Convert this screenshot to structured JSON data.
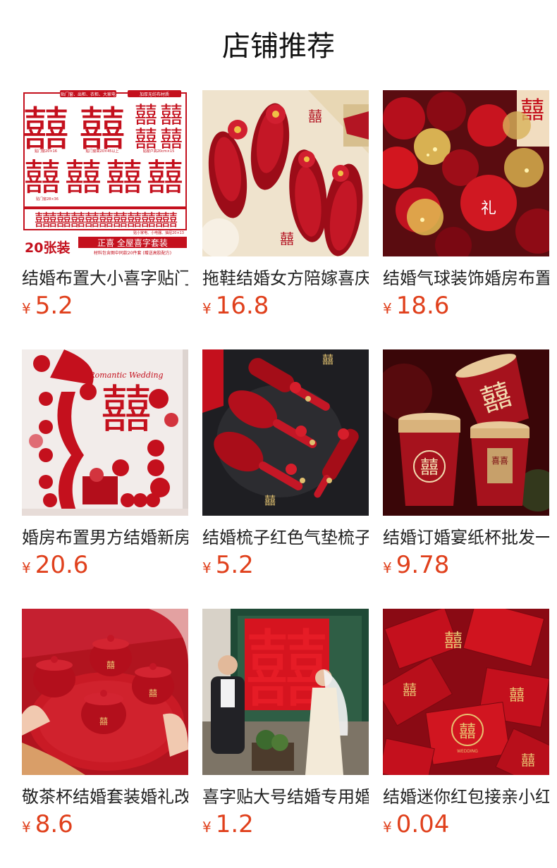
{
  "page_title": "店铺推荐",
  "products": [
    {
      "name": "结婚布置大小喜字贴门窗贴",
      "currency": "¥",
      "price": "5.2",
      "image_text": {
        "top1": "贴门窗、出柜、衣柜、大家电",
        "top2": "加厚无纺布材质",
        "big": "囍",
        "count": "20张装",
        "banner": "正喜  全屋喜字套装",
        "note": "材料包含图中同款20件套 (赠送高胶配方)",
        "small1": "贴门窗20×16",
        "small2": "贴门窗高20×45以上",
        "small3": "贴窗户高20cm×15",
        "small4": "贴门窗28×36",
        "small5": "贴小家电、小电器、抽屉20×13"
      }
    },
    {
      "name": "拖鞋结婚女方陪嫁喜庆红色",
      "currency": "¥",
      "price": "16.8",
      "image_text": {
        "big": "囍"
      }
    },
    {
      "name": "结婚气球装饰婚房布置套装",
      "currency": "¥",
      "price": "18.6",
      "image_text": {
        "big": "囍",
        "mark": "礼"
      }
    },
    {
      "name": "婚房布置男方结婚新房装饰",
      "currency": "¥",
      "price": "20.6",
      "image_text": {
        "big": "囍",
        "script": "Romantic Wedding"
      }
    },
    {
      "name": "结婚梳子红色气垫梳子陪嫁",
      "currency": "¥",
      "price": "5.2",
      "image_text": {
        "big": "囍"
      }
    },
    {
      "name": "结婚订婚宴纸杯批发一次性",
      "currency": "¥",
      "price": "9.78",
      "image_text": {
        "big": "囍",
        "cup": "喜喜"
      }
    },
    {
      "name": "敬茶杯结婚套装婚礼改口盖碗",
      "currency": "¥",
      "price": "8.6",
      "image_text": {
        "big": "囍"
      }
    },
    {
      "name": "喜字贴大号结婚专用婚房布置",
      "currency": "¥",
      "price": "1.2",
      "image_text": {
        "big": "囍"
      }
    },
    {
      "name": "结婚迷你红包接亲小红包袋",
      "currency": "¥",
      "price": "0.04",
      "image_text": {
        "big": "囍",
        "wedding": "WEDDING"
      }
    }
  ],
  "colors": {
    "price": "#e0401c",
    "accent_red": "#c4101d",
    "deep_red": "#8e0a14",
    "gold": "#d8b060"
  }
}
